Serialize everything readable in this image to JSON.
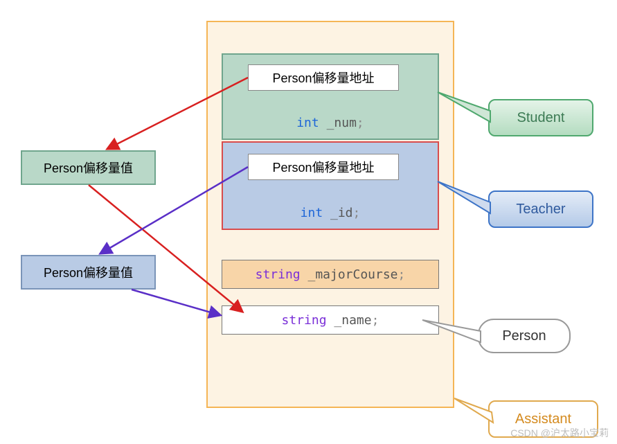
{
  "left": {
    "green_offset_value": "Person偏移量值",
    "blue_offset_value": "Person偏移量值"
  },
  "container": {
    "student": {
      "addr_label": "Person偏移量地址",
      "member_type": "int",
      "member_name": " _num",
      "semicolon": ";"
    },
    "teacher": {
      "addr_label": "Person偏移量地址",
      "member_type": "int",
      "member_name": " _id",
      "semicolon": ";"
    },
    "major": {
      "type": "string",
      "name": " _majorCourse",
      "semicolon": ";"
    },
    "name_member": {
      "type": "string",
      "name": " _name",
      "semicolon": ";"
    }
  },
  "callouts": {
    "student": "Student",
    "teacher": "Teacher",
    "person": "Person",
    "assistant": "Assistant"
  },
  "watermark": "CSDN @沪太路小宝莉"
}
